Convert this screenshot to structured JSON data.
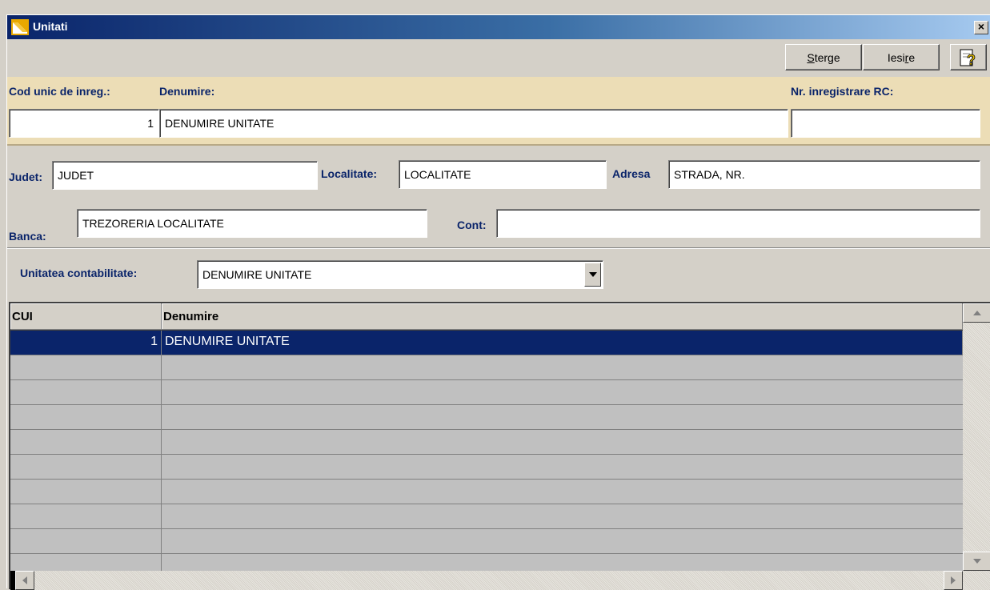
{
  "window": {
    "title": "Unitati",
    "close_glyph": "×"
  },
  "toolbar": {
    "delete_prefix": "S",
    "delete_rest": "terge",
    "exit_prefix": "Iesi",
    "exit_underlined": "r",
    "exit_rest": "e",
    "help_icon": "help-icon"
  },
  "identity": {
    "cui_label": "Cod unic de inreg.:",
    "name_label": "Denumire:",
    "rc_label": "Nr. inregistrare RC:",
    "cui_value": "1",
    "name_value": "DENUMIRE UNITATE",
    "rc_value": ""
  },
  "address": {
    "county_label": "Judet:",
    "county_value": "JUDET",
    "city_label": "Localitate:",
    "city_value": "LOCALITATE",
    "street_label": "Adresa",
    "street_value": "STRADA, NR."
  },
  "bank": {
    "bank_label": "Banca:",
    "bank_value": "TREZORERIA LOCALITATE",
    "account_label": "Cont:",
    "account_value": ""
  },
  "accounting": {
    "label": "Unitatea contabilitate:",
    "selected": "DENUMIRE UNITATE"
  },
  "grid": {
    "columns": [
      "CUI",
      "Denumire"
    ],
    "rows": [
      {
        "cui": "1",
        "name": "DENUMIRE UNITATE",
        "selected": true
      }
    ]
  },
  "colors": {
    "title_bar": "#0a246a",
    "panel_bg": "#ecddb6",
    "label_color": "#0a246a",
    "selection": "#0a246a"
  }
}
